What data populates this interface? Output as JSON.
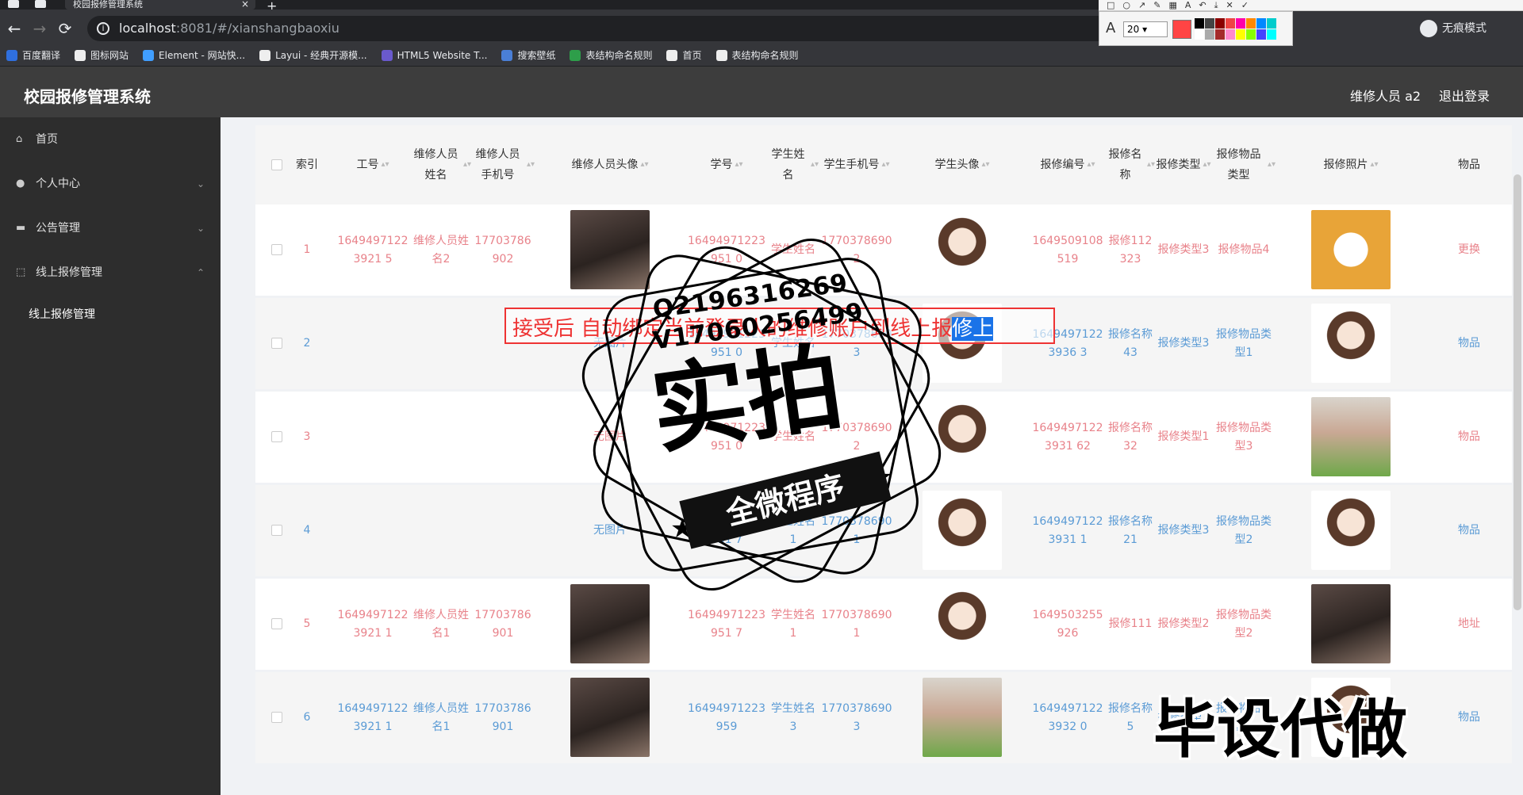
{
  "browser": {
    "tab_title": "校园报修管理系统",
    "tab_close": "×",
    "new_tab": "+",
    "url_host": "localhost",
    "url_rest": ":8081/#/xianshangbaoxiu",
    "incognito_label": "无痕模式",
    "back": "←",
    "forward": "→",
    "reload": "⟳",
    "info": "i",
    "bookmarks": [
      {
        "label": "百度翻译",
        "color": "#2f6fde"
      },
      {
        "label": "图标网站",
        "color": "#eeeeee"
      },
      {
        "label": "Element - 网站快...",
        "color": "#409eff"
      },
      {
        "label": "Layui - 经典开源模...",
        "color": "#eeeeee"
      },
      {
        "label": "HTML5 Website T...",
        "color": "#6a5acd"
      },
      {
        "label": "搜索壁纸",
        "color": "#4a7fd6"
      },
      {
        "label": "表结构命名规则",
        "color": "#2e9e4a"
      },
      {
        "label": "首页",
        "color": "#eeeeee"
      },
      {
        "label": "表结构命名规则",
        "color": "#eeeeee"
      }
    ]
  },
  "annotation_tool": {
    "font_size": "20",
    "letter": "A",
    "active_color": "#f44444",
    "palette": [
      "#000000",
      "#444444",
      "#8b0000",
      "#e44",
      "#f0a",
      "#f80",
      "#08f",
      "#0cc",
      "#ffffff",
      "#aaaaaa",
      "#a52a2a",
      "#f8c",
      "#ff0",
      "#8f0",
      "#44f",
      "#0ff"
    ]
  },
  "app": {
    "title": "校园报修管理系统",
    "user": "维修人员 a2",
    "logout": "退出登录"
  },
  "sidebar": {
    "items": [
      {
        "label": "首页",
        "icon": "home-icon",
        "glyph": "⌂"
      },
      {
        "label": "个人中心",
        "icon": "user-icon",
        "glyph": "●",
        "arrow": "⌄"
      },
      {
        "label": "公告管理",
        "icon": "briefcase-icon",
        "glyph": "▬",
        "arrow": "⌄"
      },
      {
        "label": "线上报修管理",
        "icon": "frame-icon",
        "glyph": "⬚",
        "arrow": "⌃"
      }
    ],
    "sub_items": [
      {
        "label": "线上报修管理"
      }
    ]
  },
  "table": {
    "sort_glyph": "▴▾",
    "headers": [
      "索引",
      "工号",
      "维修人员姓名",
      "维修人员手机号",
      "维修人员头像",
      "学号",
      "学生姓名",
      "学生手机号",
      "学生头像",
      "报修编号",
      "报修名称",
      "报修类型",
      "报修物品类型",
      "报修照片",
      "物品"
    ],
    "rows": [
      {
        "index": "1",
        "color": "red",
        "gonghao": "16494971223921 5",
        "wx_name": "维修人员姓名2",
        "wx_phone": "17703786902",
        "wx_avatar": "photo",
        "xuehao": "16494971223951 0",
        "stu_name": "学生姓名",
        "stu_phone": "17703786902",
        "stu_avatar": "cartoon",
        "bx_no": "1649509108519",
        "bx_name": "报修112323",
        "bx_type": "报修类型3",
        "item_type": "报修物品4",
        "photo": "cartoon-yellow",
        "extra": "更换"
      },
      {
        "index": "2",
        "color": "blue",
        "gonghao": "",
        "wx_name": "",
        "wx_phone": "",
        "wx_avatar": "无图片",
        "xuehao": "16494971223951 0",
        "stu_name": "学生姓名",
        "stu_phone": "17703786903",
        "stu_avatar": "cartoon",
        "bx_no": "16494971223936 3",
        "bx_name": "报修名称43",
        "bx_type": "报修类型3",
        "item_type": "报修物品类型1",
        "photo": "cartoon",
        "extra": "物品"
      },
      {
        "index": "3",
        "color": "red",
        "gonghao": "",
        "wx_name": "",
        "wx_phone": "",
        "wx_avatar": "无图片",
        "xuehao": "16494971223951 0",
        "stu_name": "学生姓名",
        "stu_phone": "17703786902",
        "stu_avatar": "cartoon",
        "bx_no": "16494971223931 62",
        "bx_name": "报修名称32",
        "bx_type": "报修类型1",
        "item_type": "报修物品类型3",
        "photo": "photo-green",
        "extra": "物品"
      },
      {
        "index": "4",
        "color": "blue",
        "gonghao": "",
        "wx_name": "",
        "wx_phone": "",
        "wx_avatar": "无图片",
        "xuehao": "16494971223951 7",
        "stu_name": "学生姓名1",
        "stu_phone": "17703786901",
        "stu_avatar": "cartoon",
        "bx_no": "16494971223931 1",
        "bx_name": "报修名称21",
        "bx_type": "报修类型3",
        "item_type": "报修物品类型2",
        "photo": "cartoon",
        "extra": "物品"
      },
      {
        "index": "5",
        "color": "red",
        "gonghao": "16494971223921 1",
        "wx_name": "维修人员姓名1",
        "wx_phone": "17703786901",
        "wx_avatar": "photo",
        "xuehao": "16494971223951 7",
        "stu_name": "学生姓名1",
        "stu_phone": "17703786901",
        "stu_avatar": "cartoon",
        "bx_no": "1649503255926",
        "bx_name": "报修111",
        "bx_type": "报修类型2",
        "item_type": "报修物品类型2",
        "photo": "photo",
        "extra": "地址"
      },
      {
        "index": "6",
        "color": "blue",
        "gonghao": "16494971223921 1",
        "wx_name": "维修人员姓名1",
        "wx_phone": "17703786901",
        "wx_avatar": "photo",
        "xuehao": "16494971223959",
        "stu_name": "学生姓名3",
        "stu_phone": "17703786903",
        "stu_avatar": "photo-green",
        "bx_no": "16494971223932 0",
        "bx_name": "报修名称5",
        "bx_type": "报修类型1",
        "item_type": "报修物品类型1",
        "photo": "cartoon",
        "extra": "物品"
      }
    ]
  },
  "overlay": {
    "annotation_text": "接受后 自动绑定当前登录人的维修账户到线上报",
    "annotation_selected": "修上",
    "stamp_q": "Q2196316269",
    "stamp_v": "V17060256499",
    "stamp_main": "实拍",
    "stamp_ribbon": "全微程序",
    "corner_text": "毕设代做"
  },
  "colors": {
    "red_text": "#e8828a",
    "blue_text": "#5b9bd5",
    "header_bg": "#3d3d3d",
    "sidebar_bg": "#2d2d2d"
  }
}
